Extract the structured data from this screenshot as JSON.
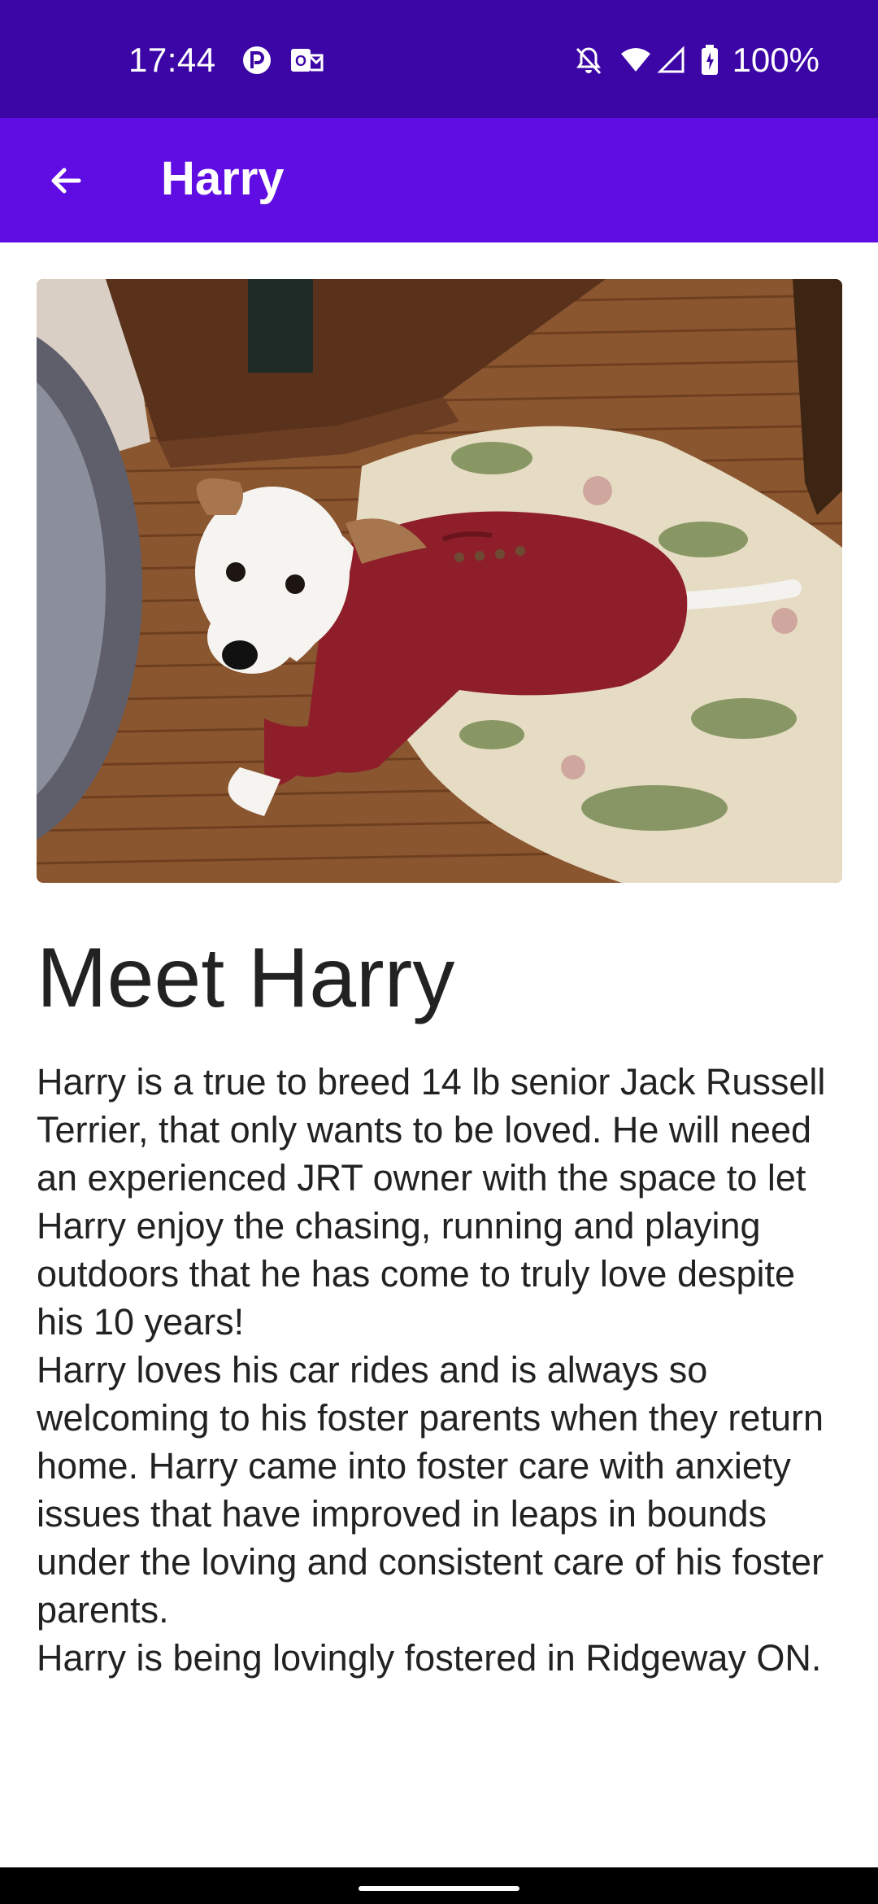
{
  "status_bar": {
    "time": "17:44",
    "left_icons": [
      "app-notification-icon",
      "outlook-mail-icon"
    ],
    "right_icons": [
      "notifications-off-icon",
      "wifi-icon",
      "cell-signal-icon",
      "battery-icon"
    ],
    "battery": "100%",
    "background": "#3c05a6"
  },
  "app_bar": {
    "title": "Harry",
    "back_icon": "arrow-back-icon",
    "background": "#5f0de3"
  },
  "pet": {
    "photo_subject": "white Jack Russell Terrier in a red sweater on a floral dog bed",
    "heading": "Meet Harry",
    "description": [
      "Harry is a true to breed 14 lb senior Jack Russell Terrier, that only wants to be loved. He will need an experienced JRT owner with the space to let Harry enjoy the chasing, running and playing outdoors that he has come to truly love despite his 10 years!",
      "Harry loves his car rides and is always so welcoming to his foster parents when they return home. Harry came into foster care with anxiety issues that have improved in leaps in bounds under the loving and consistent care of his foster parents.",
      "Harry is being lovingly fostered in Ridgeway ON."
    ]
  },
  "nav_bar": {
    "home_indicator": "gesture-home-indicator"
  }
}
